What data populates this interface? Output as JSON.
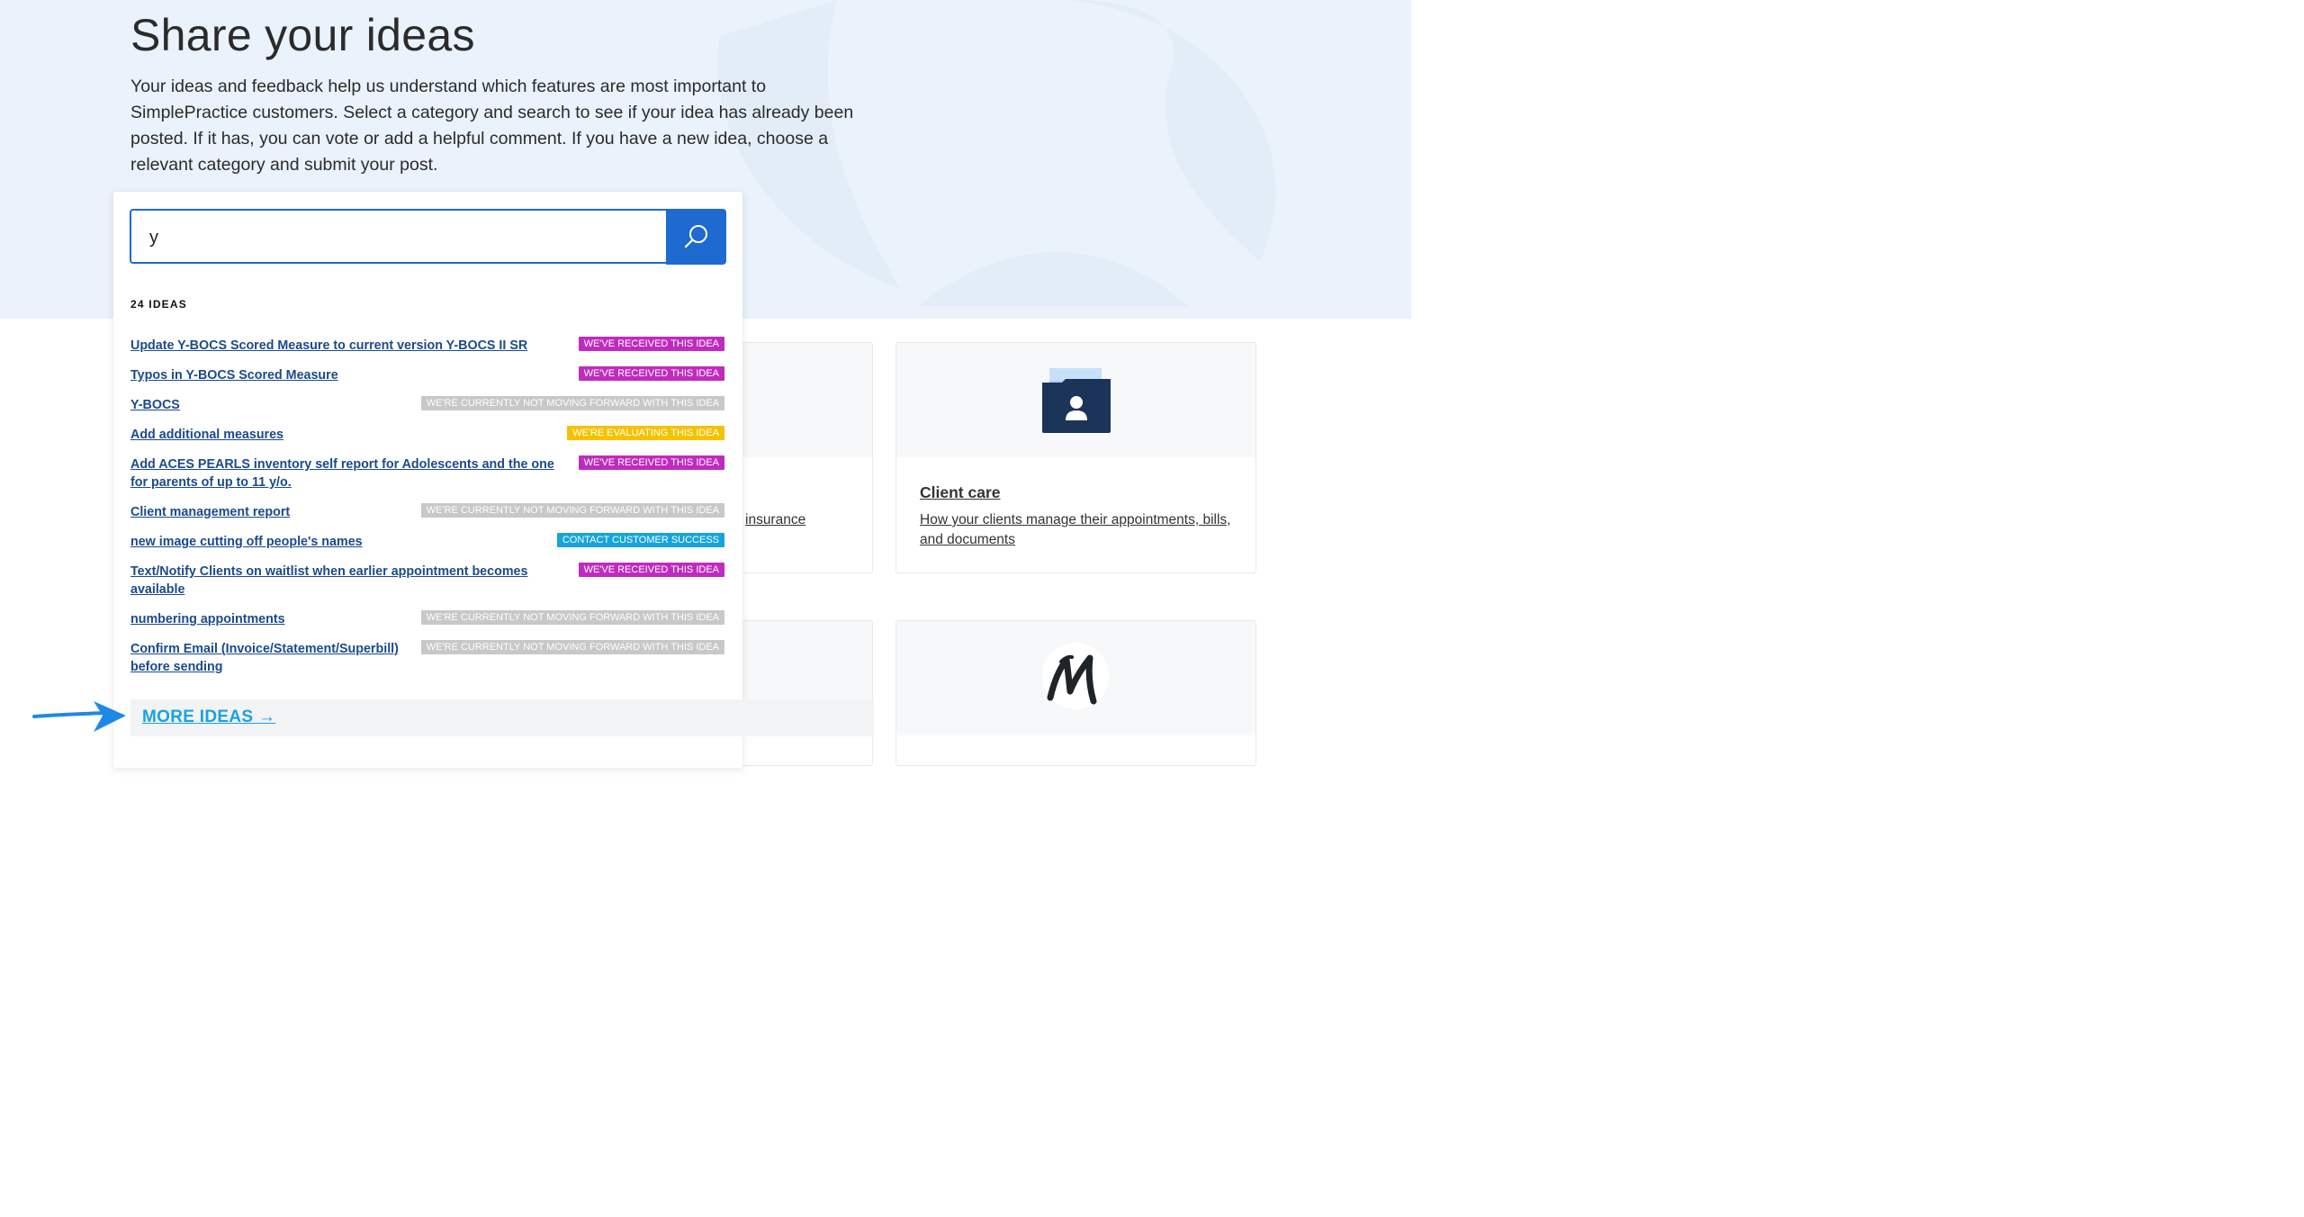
{
  "hero": {
    "title": "Share your ideas",
    "intro": "Your ideas and feedback help us understand which features are most important to SimplePractice customers. Select a category and search to see if your idea has already been posted. If it has, you can vote or add a helpful comment. If you have a new idea, choose a relevant category and submit your post."
  },
  "search": {
    "value": "y",
    "button_icon": "search-icon"
  },
  "results": {
    "count_label": "24 IDEAS",
    "items": [
      {
        "title": "Update Y-BOCS Scored Measure to current version Y-BOCS II SR",
        "status": "WE'VE RECEIVED THIS IDEA",
        "status_color": "#c02bbf"
      },
      {
        "title": "Typos in Y-BOCS Scored Measure",
        "status": "WE'VE RECEIVED THIS IDEA",
        "status_color": "#c02bbf"
      },
      {
        "title": "Y-BOCS",
        "status": "WE'RE CURRENTLY NOT MOVING FORWARD WITH THIS IDEA",
        "status_color": "#c8c8c8"
      },
      {
        "title": "Add additional measures",
        "status": "WE'RE EVALUATING THIS IDEA",
        "status_color": "#f5c200"
      },
      {
        "title_line1": "Add ACES PEARLS inventory self report for Adolescents and the one",
        "title_line2": "for parents of up to 11 y/o.",
        "status": "WE'VE RECEIVED THIS IDEA",
        "status_color": "#c02bbf"
      },
      {
        "title": "Client management report",
        "status": "WE'RE CURRENTLY NOT MOVING FORWARD WITH THIS IDEA",
        "status_color": "#c8c8c8"
      },
      {
        "title": "new image cutting off people's names",
        "status": "CONTACT CUSTOMER SUCCESS",
        "status_color": "#16a4dc"
      },
      {
        "title_line1": "Text/Notify Clients on waitlist when earlier appointment becomes",
        "title_line2": "available",
        "status": "WE'VE RECEIVED THIS IDEA",
        "status_color": "#c02bbf"
      },
      {
        "title": "numbering appointments",
        "status": "WE'RE CURRENTLY NOT MOVING FORWARD WITH THIS IDEA",
        "status_color": "#c8c8c8"
      },
      {
        "title_line1": "Confirm Email (Invoice/Statement/Superbill)",
        "title_line2": "before sending",
        "status": "WE'RE CURRENTLY NOT MOVING FORWARD WITH THIS IDEA",
        "status_color": "#c8c8c8"
      }
    ],
    "more_label": "MORE IDEAS →"
  },
  "cards": {
    "left_fragment": "insurance",
    "client_care": {
      "title": "Client care",
      "desc_line1": "How your clients manage their appointments, bills,",
      "desc_line2": "and documents",
      "icon": "client-folder-icon"
    },
    "monarch": {
      "icon": "monarch-logo"
    }
  },
  "colors": {
    "accent": "#1e6ad0",
    "link": "#1b4a8c",
    "hero_bg": "#eaf2fb"
  }
}
